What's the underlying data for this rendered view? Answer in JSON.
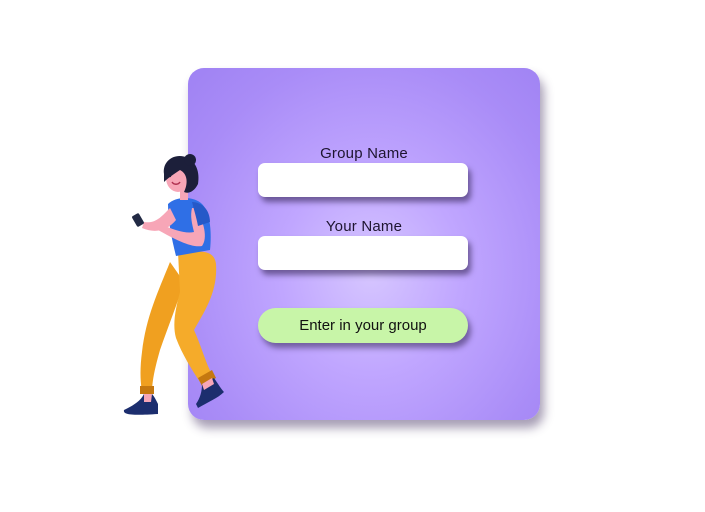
{
  "form": {
    "group_name_label": "Group Name",
    "group_name_value": "",
    "your_name_label": "Your Name",
    "your_name_value": "",
    "submit_label": "Enter in your group"
  },
  "illustration": {
    "icon": "woman-with-phone-illustration"
  },
  "colors": {
    "card_background": "#b39bfa",
    "button_background": "#c8f5a8",
    "input_background": "#ffffff"
  }
}
